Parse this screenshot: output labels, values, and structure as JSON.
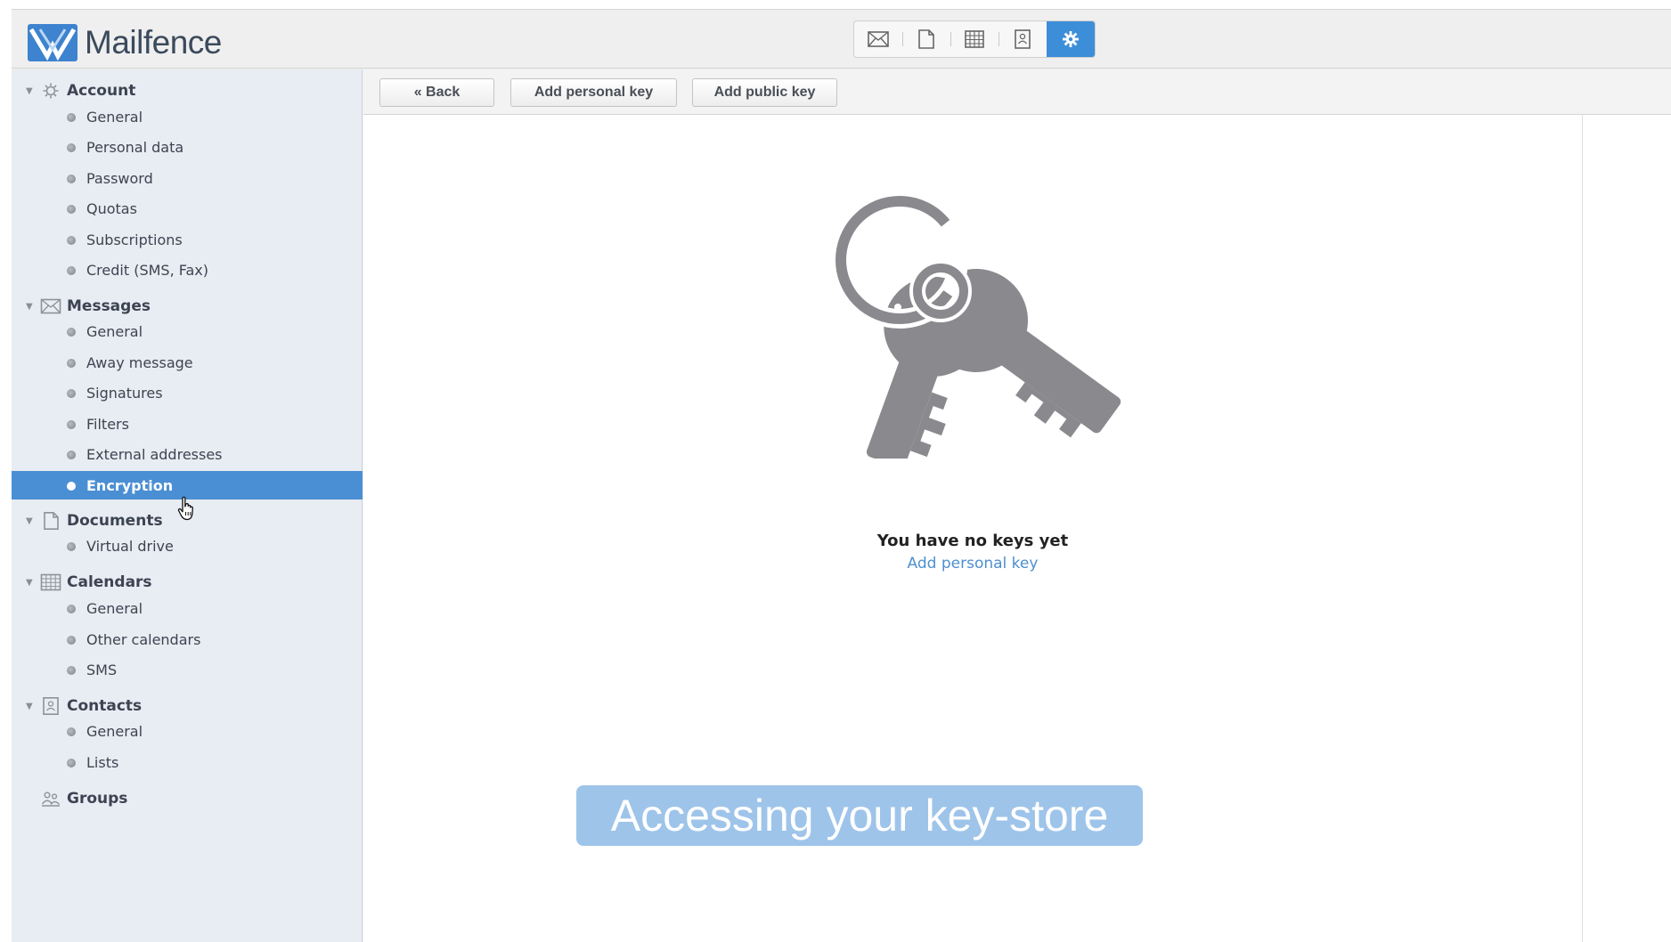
{
  "app": {
    "name": "Mailfence"
  },
  "appbar": {
    "items": [
      {
        "icon": "envelope-icon"
      },
      {
        "icon": "document-icon"
      },
      {
        "icon": "calendar-grid-icon"
      },
      {
        "icon": "contact-card-icon"
      },
      {
        "icon": "gear-icon",
        "active": true
      }
    ]
  },
  "toolbar": {
    "back": "« Back",
    "add_personal_key": "Add personal key",
    "add_public_key": "Add public key"
  },
  "sidebar": {
    "account": {
      "label": "Account",
      "items": [
        "General",
        "Personal data",
        "Password",
        "Quotas",
        "Subscriptions",
        "Credit (SMS, Fax)"
      ]
    },
    "messages": {
      "label": "Messages",
      "items": [
        "General",
        "Away message",
        "Signatures",
        "Filters",
        "External addresses",
        "Encryption"
      ]
    },
    "documents": {
      "label": "Documents",
      "items": [
        "Virtual drive"
      ]
    },
    "calendars": {
      "label": "Calendars",
      "items": [
        "General",
        "Other calendars",
        "SMS"
      ]
    },
    "contacts": {
      "label": "Contacts",
      "items": [
        "General",
        "Lists"
      ]
    },
    "groups": {
      "label": "Groups"
    },
    "selected": "Encryption"
  },
  "empty_state": {
    "title": "You have no keys yet",
    "link": "Add personal key"
  },
  "caption": "Accessing your key-store",
  "colors": {
    "accent": "#4a8fd3",
    "link": "#4d8fcf",
    "key_gray": "#8a8a8e",
    "caption_bg": "#9ec4ea"
  }
}
